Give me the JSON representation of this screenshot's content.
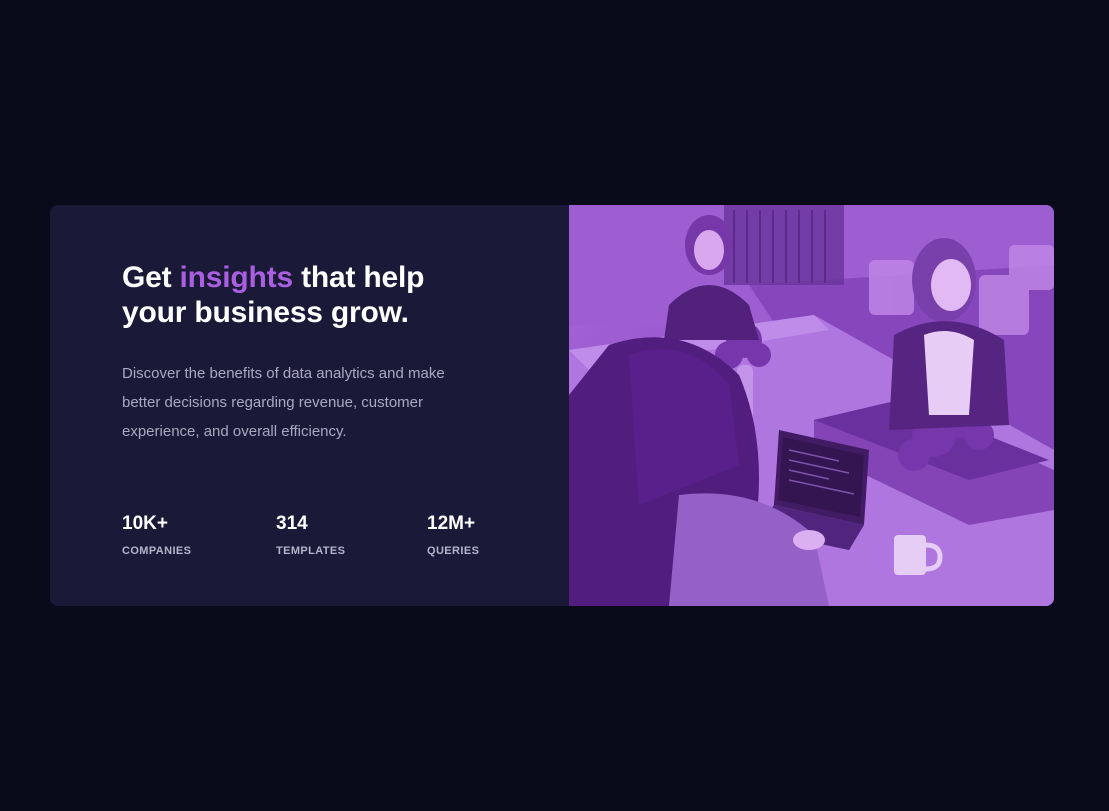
{
  "hero": {
    "headline_prefix": "Get ",
    "headline_accent": "insights",
    "headline_suffix": " that help your business grow.",
    "description": "Discover the benefits of data analytics and make better decisions regarding revenue, customer experience, and overall efficiency.",
    "accent_color": "#a95fe0"
  },
  "stats": [
    {
      "value": "10K+",
      "label": "companies"
    },
    {
      "value": "314",
      "label": "templates"
    },
    {
      "value": "12M+",
      "label": "queries"
    }
  ],
  "image": {
    "subject": "office-team-working-photo",
    "tint_color": "#aa5cdb"
  }
}
